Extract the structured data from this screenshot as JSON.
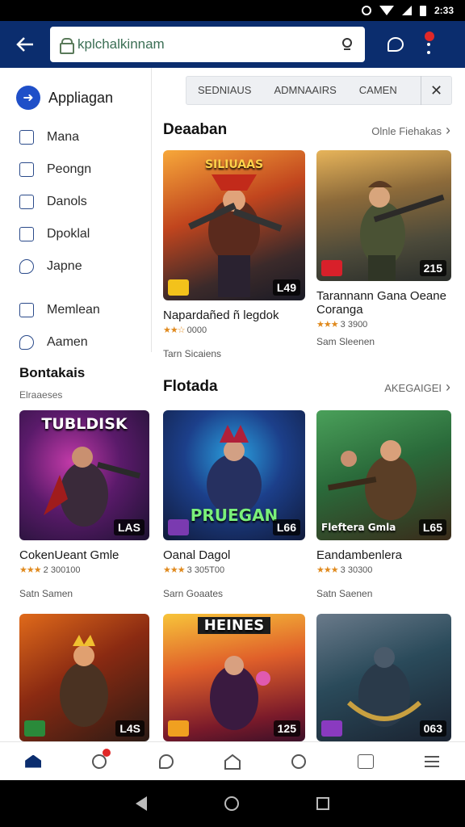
{
  "status_bar": {
    "time": "2:33"
  },
  "app_bar": {
    "search_value": "kplchalkinnam",
    "colors": {
      "bar": "#0b2d6e",
      "accent": "#1f4fc8"
    }
  },
  "sidebar": {
    "header_label": "Appliagan",
    "items": [
      {
        "label": "Mana",
        "icon": "calendar-icon"
      },
      {
        "label": "Peongn",
        "icon": "page-icon"
      },
      {
        "label": "Danols",
        "icon": "document-icon"
      },
      {
        "label": "Dpoklal",
        "icon": "edit-icon"
      },
      {
        "label": "Japne",
        "icon": "chat-bubble-icon"
      },
      {
        "label": "Memlean",
        "icon": "list-icon"
      },
      {
        "label": "Aamen",
        "icon": "gamepad-icon"
      }
    ]
  },
  "filters": {
    "chips": [
      "SEDNIAUS",
      "ADMNAAIRS",
      "CAMEN"
    ]
  },
  "section1": {
    "title": "Deaaban",
    "link": "Olnle Fiehakas",
    "cards": [
      {
        "title": "Napardañed ñ legdok",
        "stars": "★★☆",
        "rating": "0000",
        "dev": "Tarn Sicaiens",
        "badge": "L49",
        "caption": "SILIUAAS"
      },
      {
        "title": "Tarannann Gana Oeane Coranga",
        "stars": "★★★",
        "rating": "3 3900",
        "dev": "Sam Sleenen",
        "badge": "215",
        "caption": ""
      }
    ]
  },
  "section2": {
    "title": "Bontakais",
    "subtitle": "Elraaeses",
    "cards": [
      {
        "title": "CokenUeant Gmle",
        "stars": "★★★",
        "rating": "2 300100",
        "dev": "Satn Samen",
        "badge": "LAS",
        "caption": "TUBLDISK"
      }
    ]
  },
  "section3": {
    "title": "Flotada",
    "link": "AKEGAIGEI",
    "cards": [
      {
        "title": "Oanal Dagol",
        "stars": "★★★",
        "rating": "3 305T00",
        "dev": "Sarn Goaates",
        "badge": "L66",
        "caption": "PRUEGAN"
      },
      {
        "title": "Eandambenlera",
        "stars": "★★★",
        "rating": "3 30300",
        "dev": "Satn Saenen",
        "badge": "L65",
        "caption": "Fleftera Gmla"
      }
    ]
  },
  "section4": {
    "cards": [
      {
        "badge": "L4S",
        "caption": ""
      },
      {
        "badge": "125",
        "caption": "HEINES"
      },
      {
        "badge": "063",
        "caption": ""
      }
    ]
  },
  "bottom_nav": {
    "items": [
      "home-icon",
      "search-icon",
      "chat-icon",
      "house-icon",
      "clock-icon",
      "search-square-icon",
      "menu-icon"
    ]
  }
}
